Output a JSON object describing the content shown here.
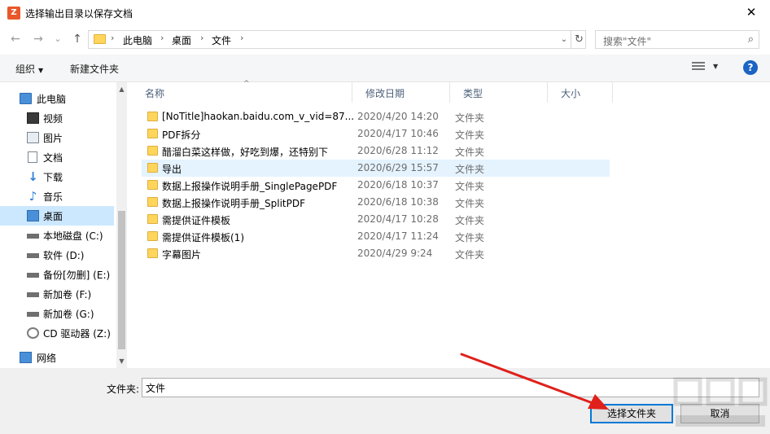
{
  "window": {
    "title": "选择输出目录以保存文档",
    "close_glyph": "✕",
    "app_icon_text": "Z"
  },
  "nav": {
    "back": "←",
    "forward": "→",
    "recent": "⌄",
    "up": "↑"
  },
  "address": {
    "crumbs": [
      "此电脑",
      "桌面",
      "文件"
    ],
    "separator": "›",
    "dropdown": "⌄",
    "refresh": "↻"
  },
  "search": {
    "placeholder": "搜索\"文件\"",
    "icon": "⌕"
  },
  "toolbar": {
    "organize": "组织",
    "new_folder": "新建文件夹",
    "help": "?"
  },
  "sidebar": {
    "items": [
      {
        "label": "此电脑",
        "icon": "pc-icon"
      },
      {
        "label": "视频",
        "icon": "video-icon"
      },
      {
        "label": "图片",
        "icon": "pictures-icon"
      },
      {
        "label": "文档",
        "icon": "documents-icon"
      },
      {
        "label": "下载",
        "icon": "downloads-icon"
      },
      {
        "label": "音乐",
        "icon": "music-icon"
      },
      {
        "label": "桌面",
        "icon": "desktop-icon",
        "selected": true
      },
      {
        "label": "本地磁盘 (C:)",
        "icon": "drive-icon"
      },
      {
        "label": "软件 (D:)",
        "icon": "drive-icon"
      },
      {
        "label": "备份[勿删] (E:)",
        "icon": "drive-icon"
      },
      {
        "label": "新加卷 (F:)",
        "icon": "drive-icon"
      },
      {
        "label": "新加卷 (G:)",
        "icon": "drive-icon"
      },
      {
        "label": "CD 驱动器 (Z:)",
        "icon": "cd-drive-icon"
      },
      {
        "label": "网络",
        "icon": "network-icon"
      }
    ]
  },
  "columns": {
    "name": "名称",
    "modified": "修改日期",
    "type": "类型",
    "size": "大小"
  },
  "files": [
    {
      "name": "[NoTitle]haokan.baidu.com_v_vid=87...",
      "modified": "2020/4/20 14:20",
      "type": "文件夹"
    },
    {
      "name": "PDF拆分",
      "modified": "2020/4/17 10:46",
      "type": "文件夹"
    },
    {
      "name": "醋溜白菜这样做，好吃到爆，还特别下",
      "modified": "2020/6/28 11:12",
      "type": "文件夹"
    },
    {
      "name": "导出",
      "modified": "2020/6/29 15:57",
      "type": "文件夹",
      "highlighted": true
    },
    {
      "name": "数据上报操作说明手册_SinglePagePDF",
      "modified": "2020/6/18 10:37",
      "type": "文件夹"
    },
    {
      "name": "数据上报操作说明手册_SplitPDF",
      "modified": "2020/6/18 10:38",
      "type": "文件夹"
    },
    {
      "name": "需提供证件模板",
      "modified": "2020/4/17 10:28",
      "type": "文件夹"
    },
    {
      "name": "需提供证件模板(1)",
      "modified": "2020/4/17 11:24",
      "type": "文件夹"
    },
    {
      "name": "字幕图片",
      "modified": "2020/4/29 9:24",
      "type": "文件夹"
    }
  ],
  "footer": {
    "folder_label": "文件夹:",
    "folder_value": "文件",
    "select_button": "选择文件夹",
    "cancel_button": "取消"
  },
  "colors": {
    "accent": "#0078d7",
    "selection": "#cce8ff",
    "hover": "#e5f3ff",
    "arrow": "#e0201b"
  }
}
